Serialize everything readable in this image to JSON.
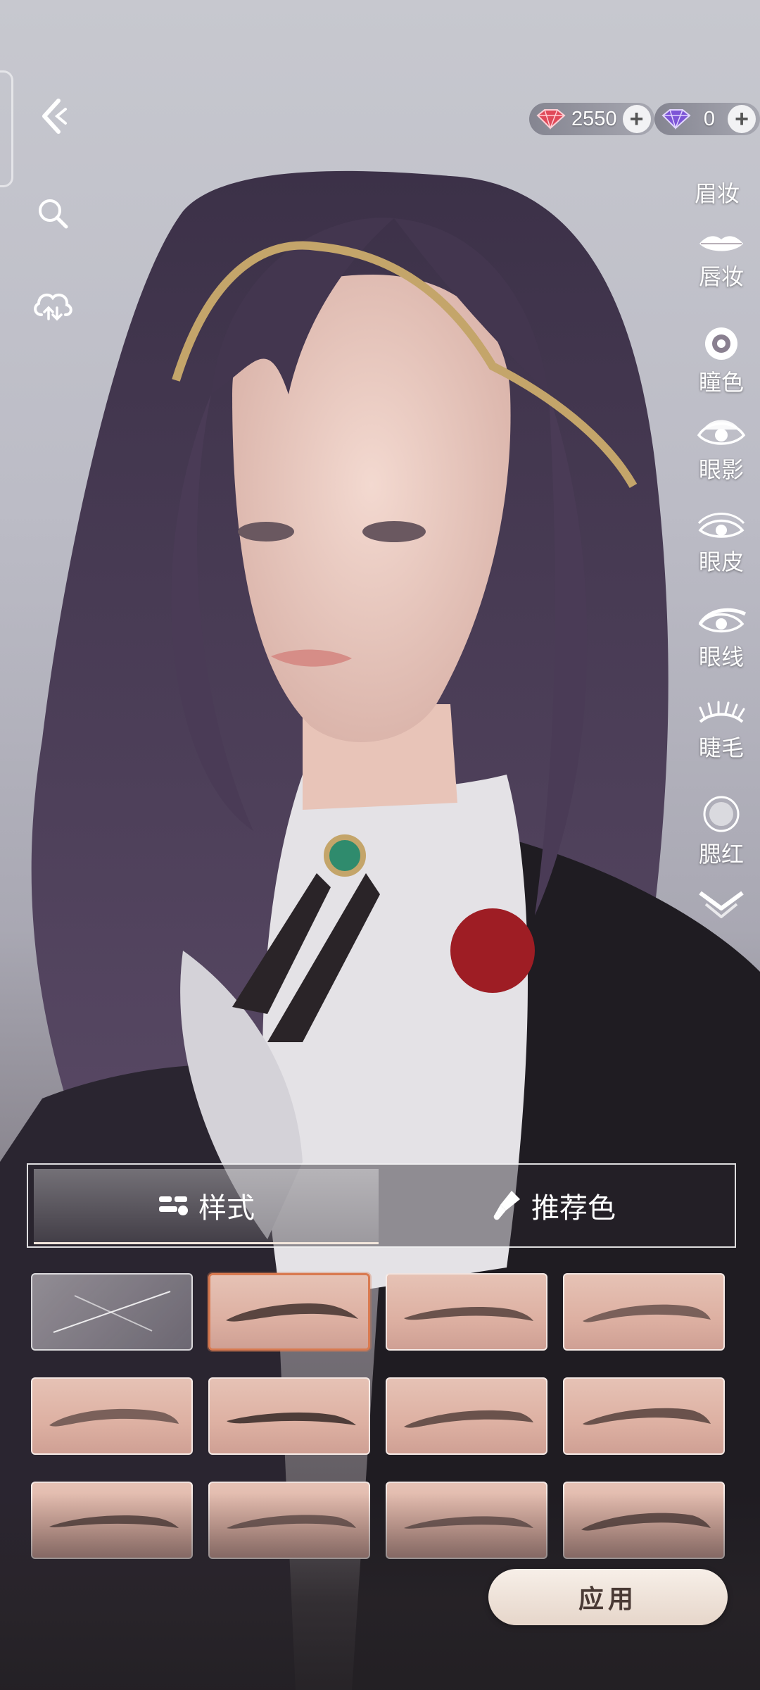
{
  "currency": {
    "ruby": {
      "icon": "red-gem-icon",
      "amount": "2550"
    },
    "amethyst": {
      "icon": "purple-gem-icon",
      "amount": "0"
    }
  },
  "left_toolbar": [
    "back-icon",
    "search-icon",
    "cloud-sync-icon"
  ],
  "categories": {
    "current": "眉妆",
    "items": [
      {
        "icon": "lips-icon",
        "label": "唇妆"
      },
      {
        "icon": "pupil-icon",
        "label": "瞳色"
      },
      {
        "icon": "eyeshadow-icon",
        "label": "眼影"
      },
      {
        "icon": "eyelid-icon",
        "label": "眼皮"
      },
      {
        "icon": "eyeliner-icon",
        "label": "眼线"
      },
      {
        "icon": "eyelash-icon",
        "label": "睫毛"
      },
      {
        "icon": "blush-icon",
        "label": "腮红"
      }
    ],
    "more_icon": "chevron-down-icon"
  },
  "tabs": {
    "style": {
      "label": "样式",
      "icon": "style-icon",
      "active": true
    },
    "recommended": {
      "label": "推荐色",
      "icon": "brush-icon",
      "active": false
    }
  },
  "styles": {
    "selected_index": 1,
    "count": 12
  },
  "apply_label": "应用",
  "colors": {
    "accent": "#d97a50",
    "apply_bg": "#f2e8e0",
    "hair": "#4b3c55"
  }
}
